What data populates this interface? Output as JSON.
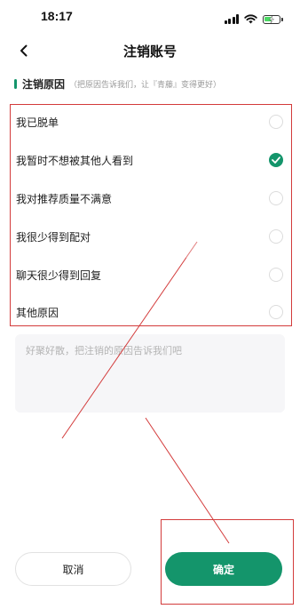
{
  "status_bar": {
    "time": "18:17",
    "icons": [
      "cellular-signal-icon",
      "wifi-icon",
      "battery-charging-icon"
    ],
    "battery_level": 0.6
  },
  "header": {
    "back_icon": "chevron-left-icon",
    "title": "注销账号"
  },
  "section": {
    "title": "注销原因",
    "hint": "（把原因告诉我们，让『青藤』变得更好）"
  },
  "reasons": [
    {
      "label": "我已脱单",
      "checked": false
    },
    {
      "label": "我暂时不想被其他人看到",
      "checked": true
    },
    {
      "label": "我对推荐质量不满意",
      "checked": false
    },
    {
      "label": "我很少得到配对",
      "checked": false
    },
    {
      "label": "聊天很少得到回复",
      "checked": false
    },
    {
      "label": "其他原因",
      "checked": false
    }
  ],
  "feedback": {
    "placeholder": "好聚好散，把注销的原因告诉我们吧",
    "value": ""
  },
  "buttons": {
    "cancel_label": "取消",
    "confirm_label": "确定"
  },
  "colors": {
    "accent": "#14956b",
    "annotation": "#d33b3b"
  }
}
